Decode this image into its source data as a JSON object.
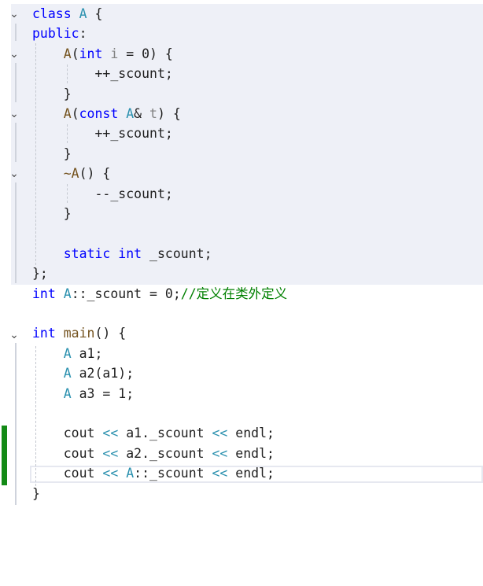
{
  "editor": {
    "lines": [
      [
        {
          "t": "class",
          "c": "kw"
        },
        {
          "t": " "
        },
        {
          "t": "A",
          "c": "ty"
        },
        {
          "t": " {"
        }
      ],
      [
        {
          "t": "public",
          "c": "kw"
        },
        {
          "t": ":"
        }
      ],
      [
        {
          "t": "    "
        },
        {
          "t": "A",
          "c": "fn"
        },
        {
          "t": "("
        },
        {
          "t": "int",
          "c": "kw"
        },
        {
          "t": " "
        },
        {
          "t": "i",
          "c": "param"
        },
        {
          "t": " = 0) {"
        }
      ],
      [
        {
          "t": "        ++_scount;"
        }
      ],
      [
        {
          "t": "    }"
        }
      ],
      [
        {
          "t": "    "
        },
        {
          "t": "A",
          "c": "fn"
        },
        {
          "t": "("
        },
        {
          "t": "const",
          "c": "kw"
        },
        {
          "t": " "
        },
        {
          "t": "A",
          "c": "ty"
        },
        {
          "t": "& "
        },
        {
          "t": "t",
          "c": "param"
        },
        {
          "t": ") {"
        }
      ],
      [
        {
          "t": "        ++_scount;"
        }
      ],
      [
        {
          "t": "    }"
        }
      ],
      [
        {
          "t": "    "
        },
        {
          "t": "~A",
          "c": "fn"
        },
        {
          "t": "() {"
        }
      ],
      [
        {
          "t": "        --_scount;"
        }
      ],
      [
        {
          "t": "    }"
        }
      ],
      [
        {
          "t": ""
        }
      ],
      [
        {
          "t": "    "
        },
        {
          "t": "static",
          "c": "kw"
        },
        {
          "t": " "
        },
        {
          "t": "int",
          "c": "kw"
        },
        {
          "t": " _scount;"
        }
      ],
      [
        {
          "t": "};"
        }
      ],
      [
        {
          "t": "int",
          "c": "kw"
        },
        {
          "t": " "
        },
        {
          "t": "A",
          "c": "ty"
        },
        {
          "t": "::_scount = 0;"
        },
        {
          "t": "//定义在类外定义",
          "c": "cm"
        }
      ],
      [
        {
          "t": ""
        }
      ],
      [
        {
          "t": "int",
          "c": "kw"
        },
        {
          "t": " "
        },
        {
          "t": "main",
          "c": "fn"
        },
        {
          "t": "() {"
        }
      ],
      [
        {
          "t": "    "
        },
        {
          "t": "A",
          "c": "ty"
        },
        {
          "t": " a1;"
        }
      ],
      [
        {
          "t": "    "
        },
        {
          "t": "A",
          "c": "ty"
        },
        {
          "t": " a2(a1);"
        }
      ],
      [
        {
          "t": "    "
        },
        {
          "t": "A",
          "c": "ty"
        },
        {
          "t": " a3 = 1;"
        }
      ],
      [
        {
          "t": ""
        }
      ],
      [
        {
          "t": "    cout "
        },
        {
          "t": "<<",
          "c": "ty"
        },
        {
          "t": " a1._scount "
        },
        {
          "t": "<<",
          "c": "ty"
        },
        {
          "t": " endl;"
        }
      ],
      [
        {
          "t": "    cout "
        },
        {
          "t": "<<",
          "c": "ty"
        },
        {
          "t": " a2._scount "
        },
        {
          "t": "<<",
          "c": "ty"
        },
        {
          "t": " endl;"
        }
      ],
      [
        {
          "t": "    cout "
        },
        {
          "t": "<<",
          "c": "ty"
        },
        {
          "t": " "
        },
        {
          "t": "A",
          "c": "ty"
        },
        {
          "t": "::_scount "
        },
        {
          "t": "<<",
          "c": "ty"
        },
        {
          "t": " endl;"
        }
      ],
      [
        {
          "t": "}"
        }
      ]
    ],
    "fold_icon": "chevron-down-icon",
    "colors": {
      "keyword": "#0000ff",
      "type": "#2b91af",
      "function": "#74531f",
      "parameter": "#808080",
      "comment": "#008000",
      "text": "#1f1f1f",
      "change_bar": "#138a16",
      "region_background": "#eef0f7"
    }
  }
}
